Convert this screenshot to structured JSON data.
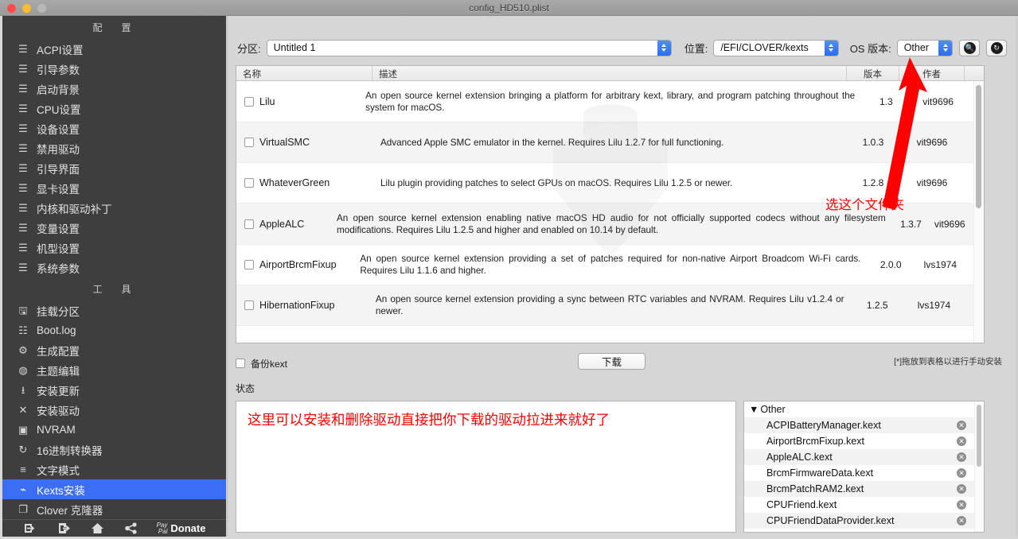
{
  "window": {
    "title": "config_HD510.plist",
    "controls": [
      "close",
      "minimize",
      "zoom"
    ]
  },
  "sidebar": {
    "config_section_title": "配　置",
    "config_items": [
      {
        "label": "ACPI设置",
        "icon": "list-icon"
      },
      {
        "label": "引导参数",
        "icon": "list-icon"
      },
      {
        "label": "启动背景",
        "icon": "list-icon"
      },
      {
        "label": "CPU设置",
        "icon": "list-icon"
      },
      {
        "label": "设备设置",
        "icon": "list-icon"
      },
      {
        "label": "禁用驱动",
        "icon": "list-icon"
      },
      {
        "label": "引导界面",
        "icon": "list-icon"
      },
      {
        "label": "显卡设置",
        "icon": "list-icon"
      },
      {
        "label": "内核和驱动补丁",
        "icon": "list-icon"
      },
      {
        "label": "变量设置",
        "icon": "list-icon"
      },
      {
        "label": "机型设置",
        "icon": "list-icon"
      },
      {
        "label": "系统参数",
        "icon": "list-icon"
      }
    ],
    "tools_section_title": "工　具",
    "tools_items": [
      {
        "label": "挂载分区",
        "icon": "disk-icon",
        "selected": false
      },
      {
        "label": "Boot.log",
        "icon": "log-search-icon",
        "selected": false
      },
      {
        "label": "生成配置",
        "icon": "gears-icon",
        "selected": false
      },
      {
        "label": "主题编辑",
        "icon": "palette-icon",
        "selected": false
      },
      {
        "label": "安装更新",
        "icon": "download-icon",
        "selected": false
      },
      {
        "label": "安装驱动",
        "icon": "tools-icon",
        "selected": false
      },
      {
        "label": "NVRAM",
        "icon": "chip-icon",
        "selected": false
      },
      {
        "label": "16进制转换器",
        "icon": "convert-icon",
        "selected": false
      },
      {
        "label": "文字模式",
        "icon": "text-lines-icon",
        "selected": false
      },
      {
        "label": "Kexts安装",
        "icon": "plug-icon",
        "selected": true
      },
      {
        "label": "Clover 克隆器",
        "icon": "copy-icon",
        "selected": false
      }
    ],
    "footer": {
      "import_icon": "import-icon",
      "export_icon": "export-icon",
      "home_icon": "home-icon",
      "share_icon": "share-icon",
      "paypal_line1": "Pay",
      "paypal_line2": "Pal",
      "donate_label": "Donate"
    }
  },
  "toolbar": {
    "partition_label": "分区:",
    "partition_value": "Untitled 1",
    "location_label": "位置:",
    "location_value": "/EFI/CLOVER/kexts",
    "os_label": "OS 版本:",
    "os_value": "Other",
    "search_icon": "search-icon",
    "refresh_icon": "refresh-icon"
  },
  "table": {
    "headers": {
      "name": "名称",
      "desc": "描述",
      "version": "版本",
      "author": "作者"
    },
    "rows": [
      {
        "name": "Lilu",
        "desc": "An open source kernel extension bringing a platform for arbitrary kext, library, and program patching throughout the system for macOS.",
        "version": "1.3",
        "author": "vit9696",
        "checked": false
      },
      {
        "name": "VirtualSMC",
        "desc": "Advanced Apple SMC emulator in the kernel. Requires Lilu 1.2.7 for full functioning.",
        "version": "1.0.3",
        "author": "vit9696",
        "checked": false
      },
      {
        "name": "WhateverGreen",
        "desc": "Lilu plugin providing patches to select GPUs on macOS. Requires Lilu 1.2.5 or newer.",
        "version": "1.2.8",
        "author": "vit9696",
        "checked": false
      },
      {
        "name": "AppleALC",
        "desc": "An open source kernel extension enabling native macOS HD audio for not officially supported codecs without any filesystem modifications. Requires Lilu 1.2.5 and higher and enabled on 10.14 by default.",
        "version": "1.3.7",
        "author": "vit9696",
        "checked": false
      },
      {
        "name": "AirportBrcmFixup",
        "desc": "An open source kernel extension providing a set of patches required for non-native Airport Broadcom Wi-Fi cards. Requires Lilu 1.1.6 and higher.",
        "version": "2.0.0",
        "author": "lvs1974",
        "checked": false
      },
      {
        "name": "HibernationFixup",
        "desc": "An open source kernel extension providing a sync between RTC variables and NVRAM. Requires Lilu v1.2.4 or newer.",
        "version": "1.2.5",
        "author": "lvs1974",
        "checked": false
      }
    ]
  },
  "actions": {
    "backup_label": "备份kext",
    "backup_checked": false,
    "download_label": "下载",
    "drag_hint": "[*]拖放到表格以进行手动安装"
  },
  "status": {
    "label": "状态",
    "annotation": "这里可以安装和删除驱动直接把你下载的驱动拉进来就好了"
  },
  "installed": {
    "group_label": "Other",
    "disclosure_icon": "triangle-down-icon",
    "items": [
      "ACPIBatteryManager.kext",
      "AirportBrcmFixup.kext",
      "AppleALC.kext",
      "BrcmFirmwareData.kext",
      "BrcmPatchRAM2.kext",
      "CPUFriend.kext",
      "CPUFriendDataProvider.kext"
    ],
    "remove_icon": "remove-circle-icon"
  },
  "annotations": {
    "arrow_icon": "red-arrow-icon",
    "folder_note": "选这个文件夹"
  },
  "colors": {
    "accent": "#3b6ef5",
    "annotation_red": "#fe0000",
    "sidebar_bg": "#3e3e3e",
    "panel_bg": "#d6d6d6"
  }
}
